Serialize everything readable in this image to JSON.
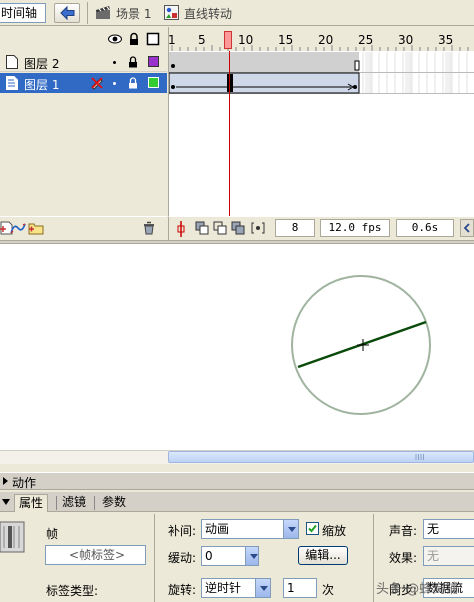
{
  "topbar": {
    "timeline_label": "时间轴",
    "scene_label": "场景 1",
    "symbol_label": "直线转动"
  },
  "layers": [
    {
      "name": "图层 2",
      "color": "#9933cc",
      "selected": false
    },
    {
      "name": "图层 1",
      "color": "#33cc33",
      "selected": true
    }
  ],
  "ruler": {
    "labels": [
      "1",
      "5",
      "10",
      "15",
      "20",
      "25",
      "30",
      "35"
    ]
  },
  "frames_footer": {
    "current_frame": "8",
    "frame_rate": "12.0 fps",
    "elapsed_time": "0.6s"
  },
  "panels": {
    "actions_label": "动作",
    "tabs": [
      "属性",
      "滤镜",
      "参数"
    ]
  },
  "properties": {
    "frame_label": "帧",
    "frame_name_placeholder": "<帧标签>",
    "label_type_label": "标签类型:",
    "tween_label": "补间:",
    "tween_value": "动画",
    "scale_label": "缩放",
    "scale_checked": true,
    "ease_label": "缓动:",
    "ease_value": "0",
    "edit_button": "编辑...",
    "rotate_label": "旋转:",
    "rotate_value": "逆时针",
    "rotate_times": "1",
    "times_unit": "次",
    "sound_label": "声音:",
    "sound_value": "无",
    "effect_label": "效果:",
    "effect_value": "无",
    "sync_label": "同步:",
    "sync_value": "数据流"
  },
  "watermark": "头条 @蜂窝铺",
  "colors": {
    "selection": "#316ac5",
    "playhead": "#ff9999",
    "line": "#0a4a0a",
    "circle": "#a0b4a0"
  }
}
